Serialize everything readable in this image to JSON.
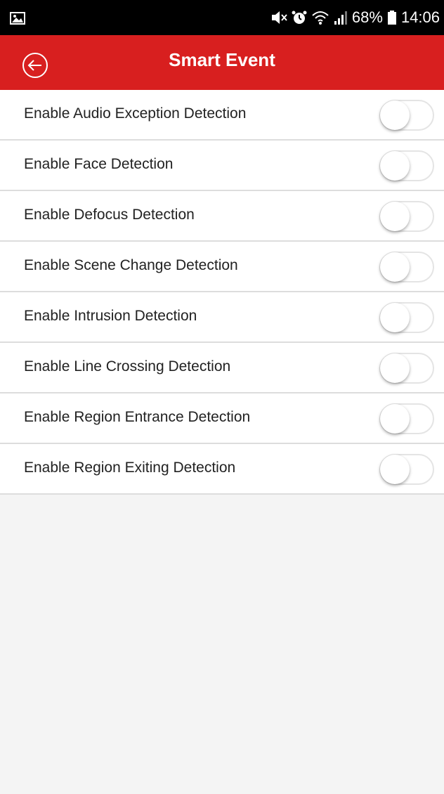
{
  "status_bar": {
    "battery": "68%",
    "time": "14:06",
    "icons": [
      "image-icon",
      "mute-icon",
      "alarm-icon",
      "wifi-icon",
      "signal-icon",
      "battery-icon"
    ]
  },
  "app_bar": {
    "title": "Smart Event",
    "back_icon": "back-arrow-icon",
    "color": "#d81f1f"
  },
  "settings": [
    {
      "label": "Enable Audio Exception Detection",
      "enabled": false
    },
    {
      "label": "Enable Face Detection",
      "enabled": false
    },
    {
      "label": "Enable Defocus Detection",
      "enabled": false
    },
    {
      "label": "Enable Scene Change Detection",
      "enabled": false
    },
    {
      "label": "Enable Intrusion Detection",
      "enabled": false
    },
    {
      "label": "Enable Line Crossing Detection",
      "enabled": false
    },
    {
      "label": "Enable Region Entrance Detection",
      "enabled": false
    },
    {
      "label": "Enable Region Exiting Detection",
      "enabled": false
    }
  ]
}
